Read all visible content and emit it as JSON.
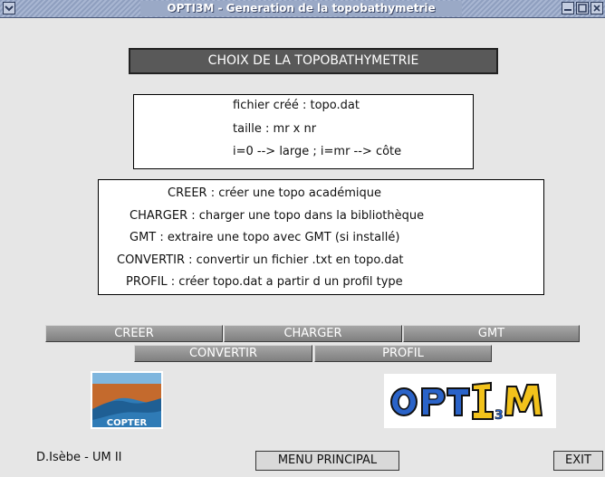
{
  "window": {
    "title": "OPTI3M - Generation de la topobathymetrie"
  },
  "heading": "CHOIX DE LA TOPOBATHYMETRIE",
  "info_box": {
    "lines": [
      "fichier créé : topo.dat",
      "taille : mr x nr",
      "i=0 --> large ; i=mr --> côte"
    ]
  },
  "help_box": {
    "lines": [
      "CREER : créer une topo académique",
      "CHARGER : charger une topo dans la bibliothèque",
      "GMT : extraire une topo avec GMT (si installé)",
      "CONVERTIR : convertir un fichier .txt en topo.dat",
      "PROFIL :  créer topo.dat a partir d un profil type"
    ]
  },
  "buttons": {
    "creer": "CREER",
    "charger": "CHARGER",
    "gmt": "GMT",
    "convertir": "CONVERTIR",
    "profil": "PROFIL"
  },
  "footer": {
    "author": "D.Isèbe - UM II",
    "menu": "MENU PRINCIPAL",
    "exit": "EXIT"
  },
  "logos": {
    "copter": "COPTER",
    "opti": "OPTI3M"
  },
  "colors": {
    "titlebar": "#9aa9c6",
    "heading_bg": "#595959",
    "button_bg": "#8c8c8c",
    "background": "#e6e6e6"
  },
  "icons": [
    "window-menu-icon",
    "minimize-icon",
    "maximize-icon",
    "close-icon"
  ]
}
